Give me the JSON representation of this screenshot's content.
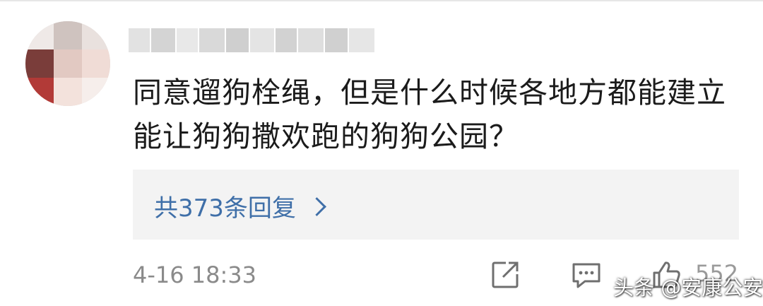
{
  "comment": {
    "text": "同意遛狗栓绳，但是什么时候各地方都能建立能让狗狗撒欢跑的狗狗公园？",
    "replies_label": "共373条回复",
    "timestamp": "4-16 18:33",
    "like_count": "552"
  },
  "icons": {
    "chevron": "chevron-right-icon",
    "share": "share-icon",
    "comment": "comment-icon",
    "like": "like-icon"
  },
  "watermark": "头条 @安康公安",
  "colors": {
    "link": "#3f6fa8",
    "text": "#1b1b1b",
    "meta": "#8a8a8a",
    "reply_box": "#f3f3f3"
  }
}
